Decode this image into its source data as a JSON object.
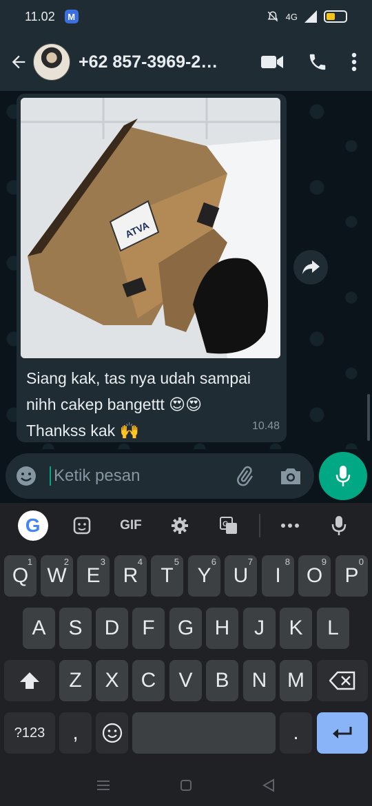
{
  "status": {
    "time": "11.02",
    "app_badge": "M",
    "network": "4G"
  },
  "header": {
    "contact": "+62 857-3969-2…"
  },
  "message": {
    "text_line1": "Siang kak, tas nya udah sampai",
    "text_line2": "nihh cakep bangettt 😍😍",
    "text_line3": "Thankss kak 🙌",
    "time": "10.48",
    "image_brand_label": "ATVA"
  },
  "input": {
    "placeholder": "Ketik pesan"
  },
  "keyboard": {
    "toolbar": {
      "gif_label": "GIF",
      "google_letter": "G"
    },
    "row1": [
      {
        "label": "Q",
        "hint": "1"
      },
      {
        "label": "W",
        "hint": "2"
      },
      {
        "label": "E",
        "hint": "3"
      },
      {
        "label": "R",
        "hint": "4"
      },
      {
        "label": "T",
        "hint": "5"
      },
      {
        "label": "Y",
        "hint": "6"
      },
      {
        "label": "U",
        "hint": "7"
      },
      {
        "label": "I",
        "hint": "8"
      },
      {
        "label": "O",
        "hint": "9"
      },
      {
        "label": "P",
        "hint": "0"
      }
    ],
    "row2": [
      "A",
      "S",
      "D",
      "F",
      "G",
      "H",
      "J",
      "K",
      "L"
    ],
    "row3": [
      "Z",
      "X",
      "C",
      "V",
      "B",
      "N",
      "M"
    ],
    "symbols_label": "?123",
    "comma_label": ",",
    "period_label": "."
  },
  "colors": {
    "accent": "#00a884",
    "bubble": "#1f2c34",
    "background": "#0b141a",
    "enter_key": "#8ab4f8"
  }
}
